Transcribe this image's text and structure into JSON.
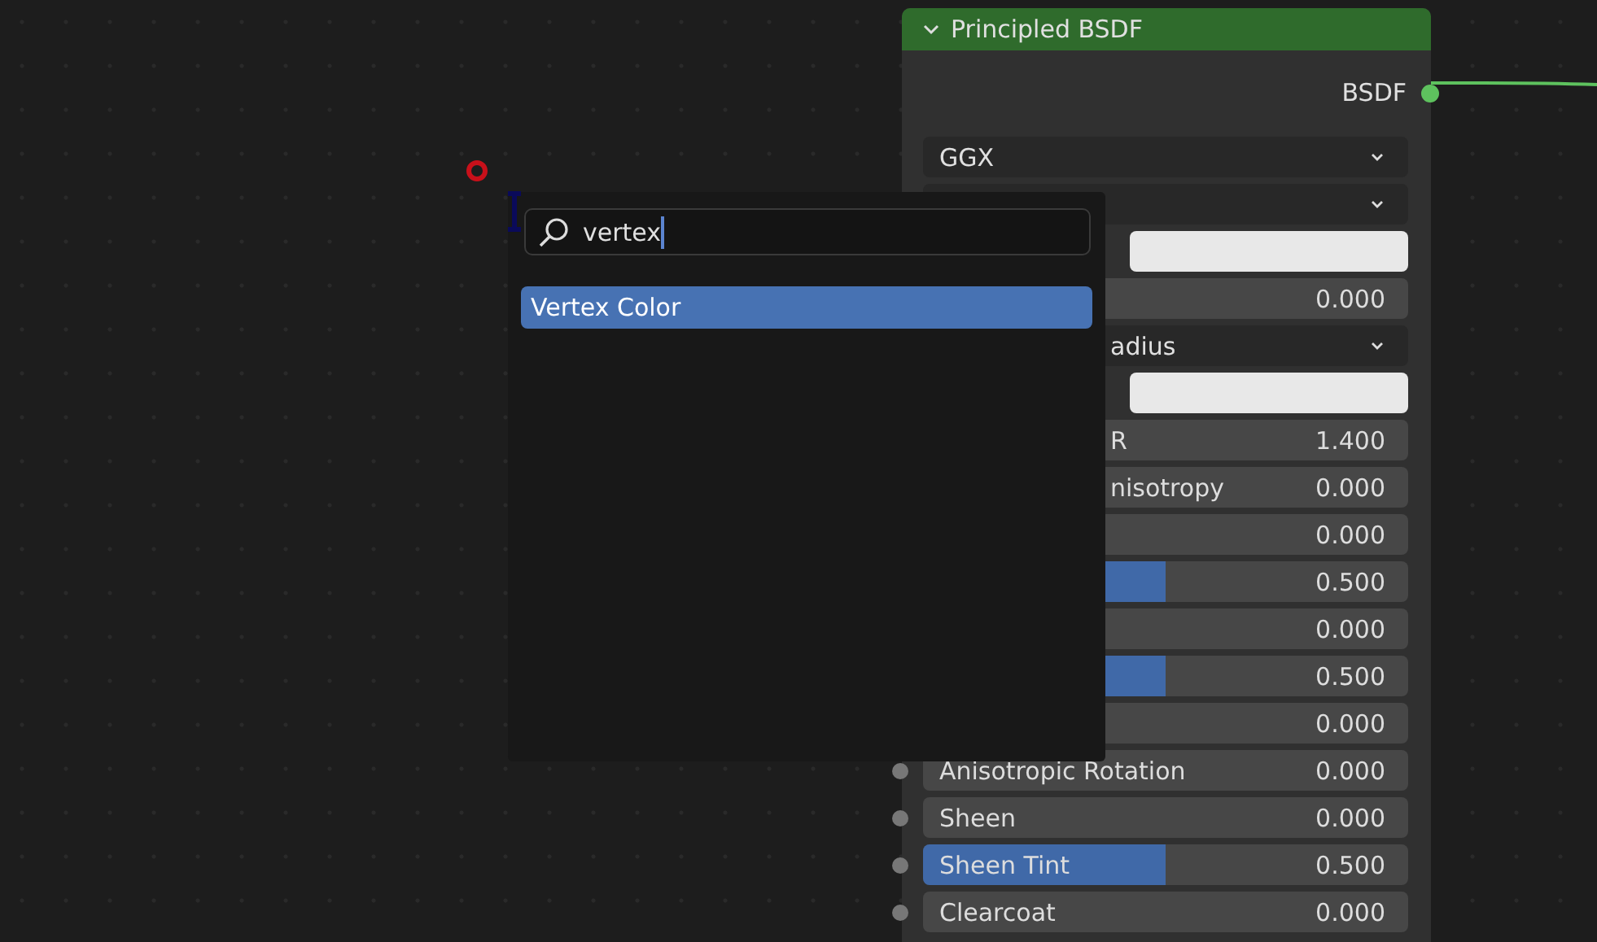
{
  "node": {
    "title": "Principled BSDF",
    "expanded": true,
    "output": "BSDF",
    "rows": [
      {
        "kind": "dropdown",
        "label": "GGX"
      },
      {
        "kind": "dropdown"
      },
      {
        "kind": "color"
      },
      {
        "kind": "value",
        "value": "0.000"
      },
      {
        "kind": "dropdown",
        "label": "adius"
      },
      {
        "kind": "color"
      },
      {
        "kind": "value",
        "label": "R",
        "value": "1.400"
      },
      {
        "kind": "value",
        "label": "nisotropy",
        "value": "0.000"
      },
      {
        "kind": "value",
        "value": "0.000"
      },
      {
        "kind": "slider",
        "value": "0.500",
        "level": 0.5
      },
      {
        "kind": "value",
        "value": "0.000"
      },
      {
        "kind": "slider",
        "value": "0.500",
        "level": 0.5
      },
      {
        "kind": "value",
        "value": "0.000"
      },
      {
        "kind": "value",
        "label": "Anisotropic Rotation",
        "value": "0.000",
        "socket": true
      },
      {
        "kind": "value",
        "label": "Sheen",
        "value": "0.000",
        "socket": true
      },
      {
        "kind": "slider",
        "label": "Sheen Tint",
        "value": "0.500",
        "level": 0.5,
        "socket": true
      },
      {
        "kind": "value",
        "label": "Clearcoat",
        "value": "0.000",
        "socket": true
      }
    ]
  },
  "search_popup": {
    "search": {
      "value": "vertex"
    },
    "results": [
      {
        "label": "Vertex Color",
        "selected": true
      }
    ]
  }
}
